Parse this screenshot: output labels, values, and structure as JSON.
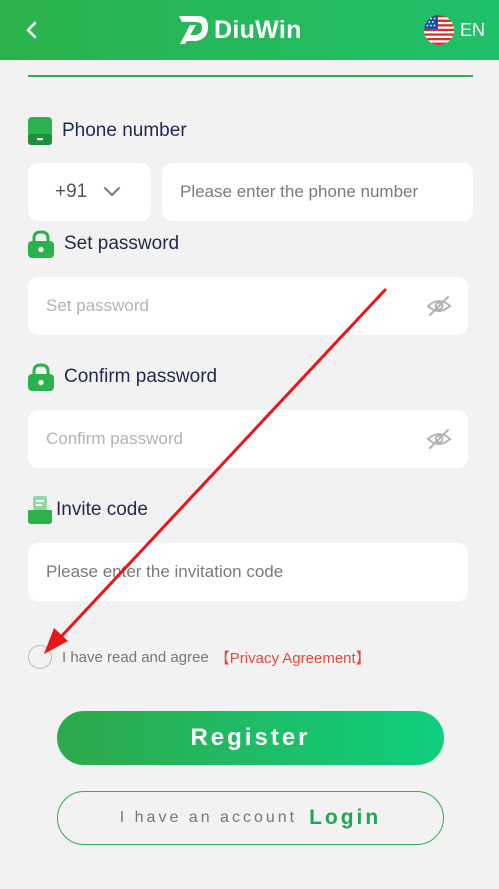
{
  "header": {
    "brand": "DiuWin",
    "language": "EN",
    "icons": {
      "back": "chevron-left-icon",
      "logo": "diuwin-logo-icon",
      "flag": "us-flag-icon"
    }
  },
  "form": {
    "phone": {
      "label": "Phone number",
      "country_code": "+91",
      "placeholder": "Please enter the phone number",
      "icon": "phone-icon"
    },
    "password": {
      "label": "Set password",
      "placeholder": "Set password",
      "icon": "lock-icon",
      "toggle_icon": "eye-off-icon"
    },
    "confirm_password": {
      "label": "Confirm password",
      "placeholder": "Confirm password",
      "icon": "lock-icon",
      "toggle_icon": "eye-off-icon"
    },
    "invite": {
      "label": "Invite code",
      "placeholder": "Please enter the invitation code",
      "icon": "invite-icon"
    },
    "agreement": {
      "text": "I have read and agree",
      "link": "【Privacy Agreement】",
      "checked": false
    }
  },
  "actions": {
    "register": "Register",
    "have_account": "I have an account",
    "login": "Login"
  },
  "colors": {
    "brand_green": "#2bb24c",
    "accent_light": "#0ecf7e",
    "link_red": "#e24a3b",
    "annotation_arrow": "#e8151b"
  }
}
